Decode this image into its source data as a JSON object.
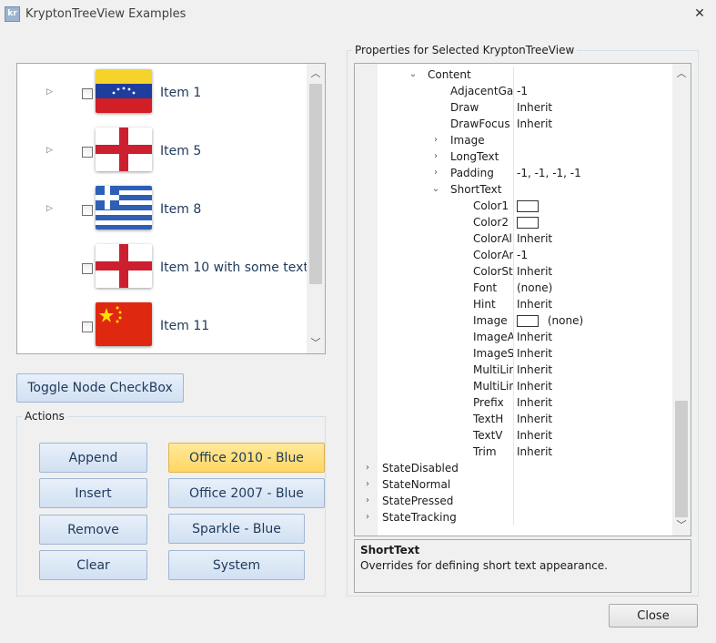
{
  "window": {
    "title": "KryptonTreeView Examples",
    "icon_text": "kr"
  },
  "tree": {
    "items": [
      {
        "label": "Item 1",
        "expandable": true,
        "flag": "venezuela"
      },
      {
        "label": "Item 5",
        "expandable": true,
        "flag": "england"
      },
      {
        "label": "Item 8",
        "expandable": true,
        "flag": "greece"
      },
      {
        "label": "Item 10 with some text",
        "expandable": false,
        "flag": "england"
      },
      {
        "label": "Item 11",
        "expandable": false,
        "flag": "china"
      }
    ]
  },
  "toggle_button": "Toggle Node CheckBox",
  "actions": {
    "title": "Actions",
    "buttons": {
      "append": "Append",
      "insert": "Insert",
      "remove": "Remove",
      "clear": "Clear"
    },
    "palettes": {
      "office2010": "Office 2010 - Blue",
      "office2007": "Office 2007 - Blue",
      "sparkle": "Sparkle - Blue",
      "system": "System"
    },
    "selected_palette": "office2010"
  },
  "properties": {
    "title": "Properties for Selected KryptonTreeView",
    "rows": [
      {
        "name": "Content",
        "value": "",
        "expander": "down"
      },
      {
        "name": "AdjacentGa",
        "value": "-1",
        "expander": ""
      },
      {
        "name": "Draw",
        "value": "Inherit",
        "expander": ""
      },
      {
        "name": "DrawFocus",
        "value": "Inherit",
        "expander": ""
      },
      {
        "name": "Image",
        "value": "",
        "expander": "right"
      },
      {
        "name": "LongText",
        "value": "",
        "expander": "right"
      },
      {
        "name": "Padding",
        "value": "-1, -1, -1, -1",
        "expander": "right"
      },
      {
        "name": "ShortText",
        "value": "",
        "expander": "down"
      },
      {
        "name": "Color1",
        "value": "",
        "expander": "",
        "swatch": true
      },
      {
        "name": "Color2",
        "value": "",
        "expander": "",
        "swatch": true
      },
      {
        "name": "ColorAl",
        "value": "Inherit",
        "expander": ""
      },
      {
        "name": "ColorAr",
        "value": "-1",
        "expander": ""
      },
      {
        "name": "ColorSt",
        "value": "Inherit",
        "expander": ""
      },
      {
        "name": "Font",
        "value": "(none)",
        "expander": ""
      },
      {
        "name": "Hint",
        "value": "Inherit",
        "expander": ""
      },
      {
        "name": "Image",
        "value": "(none)",
        "expander": "",
        "swatch": true
      },
      {
        "name": "ImageA",
        "value": "Inherit",
        "expander": ""
      },
      {
        "name": "ImageS",
        "value": "Inherit",
        "expander": ""
      },
      {
        "name": "MultiLin",
        "value": "Inherit",
        "expander": ""
      },
      {
        "name": "MultiLin",
        "value": "Inherit",
        "expander": ""
      },
      {
        "name": "Prefix",
        "value": "Inherit",
        "expander": ""
      },
      {
        "name": "TextH",
        "value": "Inherit",
        "expander": ""
      },
      {
        "name": "TextV",
        "value": "Inherit",
        "expander": ""
      },
      {
        "name": "Trim",
        "value": "Inherit",
        "expander": ""
      },
      {
        "name": "StateDisabled",
        "value": "",
        "expander": "right"
      },
      {
        "name": "StateNormal",
        "value": "",
        "expander": "right"
      },
      {
        "name": "StatePressed",
        "value": "",
        "expander": "right"
      },
      {
        "name": "StateTracking",
        "value": "",
        "expander": "right"
      }
    ],
    "help": {
      "title": "ShortText",
      "description": "Overrides for defining short text appearance."
    }
  },
  "close_button": "Close",
  "colors": {
    "button_blue": "#d1e0f2",
    "button_selected": "#ffd665",
    "tree_text": "#1e395b"
  }
}
